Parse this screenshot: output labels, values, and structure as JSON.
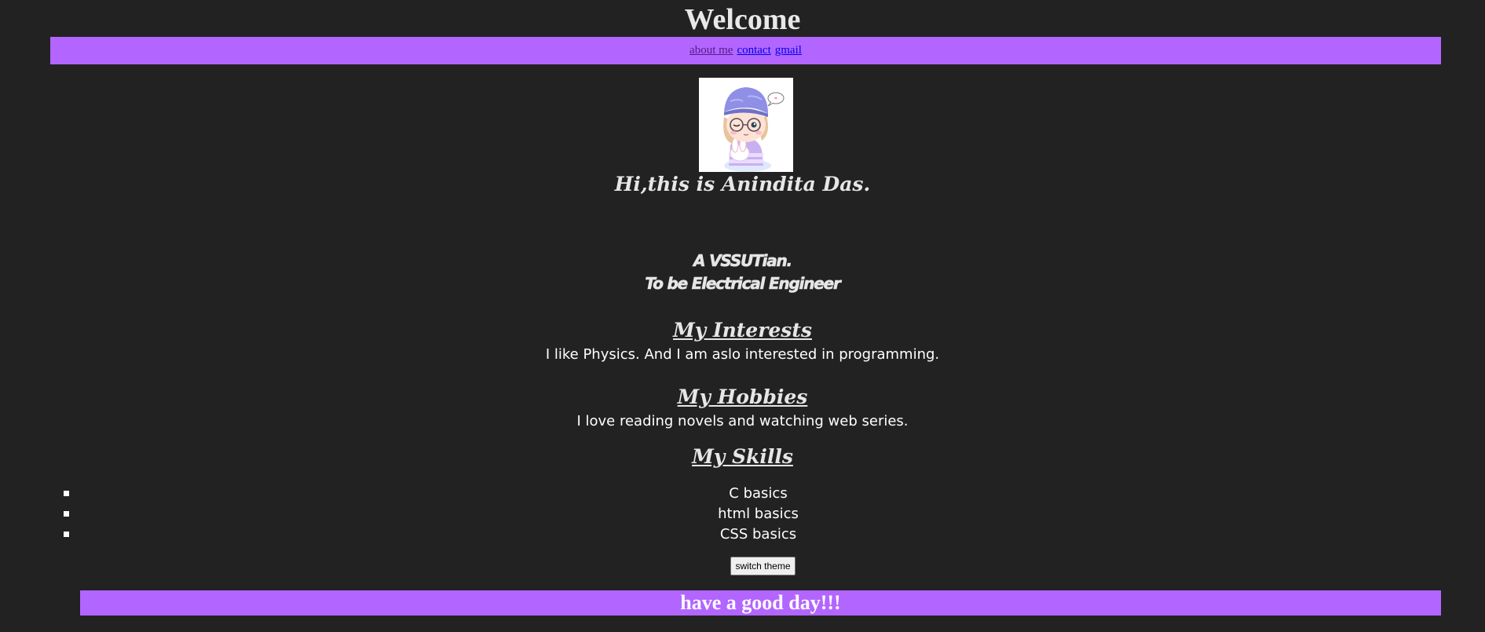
{
  "header": {
    "title": "Welcome"
  },
  "nav": {
    "links": [
      "about me",
      "contact",
      "gmail"
    ]
  },
  "profile": {
    "intro": "Hi,this is Anindita Das.",
    "tagline_1": "A VSSUTian.",
    "tagline_2": "To be Electrical Engineer"
  },
  "interests": {
    "heading": "My Interests",
    "text": "I like Physics. And I am aslo interested in programming."
  },
  "hobbies": {
    "heading": "My Hobbies",
    "text": "I love reading novels and watching web series."
  },
  "skills": {
    "heading": "My Skills",
    "items": [
      "C basics",
      "html basics",
      "CSS basics"
    ]
  },
  "theme_button": {
    "label": "switch theme"
  },
  "footer": {
    "text": "have a good day!!!"
  },
  "colors": {
    "background": "#222222",
    "accent": "#b266ff",
    "text": "#e6e6e6"
  },
  "icons": {
    "avatar": "cartoon-girl-avatar"
  }
}
